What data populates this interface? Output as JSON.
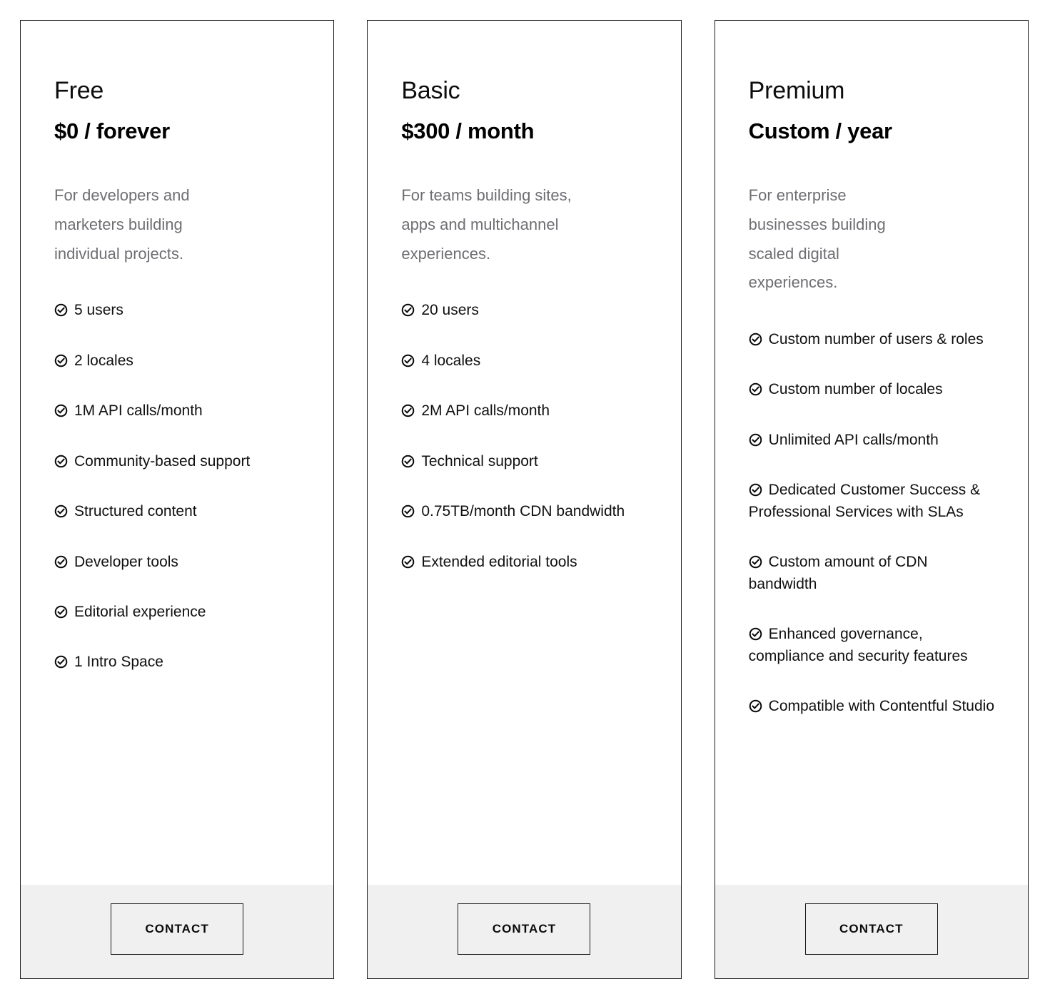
{
  "page": {
    "background": "#ffffff",
    "card_border_color": "#1a1a1a",
    "footer_background": "#f0f0f0",
    "description_color": "#6e6e73",
    "text_color": "#101010"
  },
  "icons": {
    "check": "circle-check-icon"
  },
  "plans": [
    {
      "id": "free",
      "name": "Free",
      "price": "$0 / forever",
      "description": "For developers and marketers building individual projects.",
      "features": [
        "5 users",
        "2 locales",
        "1M API calls/month",
        "Community-based support",
        "Structured content",
        "Developer tools",
        "Editorial experience",
        "1 Intro Space"
      ],
      "cta_label": "CONTACT"
    },
    {
      "id": "basic",
      "name": "Basic",
      "price": "$300 / month",
      "description": "For teams building sites, apps and multichannel experiences.",
      "features": [
        "20 users",
        "4 locales",
        "2M API calls/month",
        "Technical support",
        "0.75TB/month CDN bandwidth",
        "Extended editorial tools"
      ],
      "cta_label": "CONTACT"
    },
    {
      "id": "premium",
      "name": "Premium",
      "price": "Custom / year",
      "description": "For enterprise businesses building scaled digital experiences.",
      "features": [
        "Custom number of users & roles",
        "Custom number of locales",
        "Unlimited API calls/month",
        "Dedicated Customer Success & Professional Services with SLAs",
        "Custom amount of CDN bandwidth",
        "Enhanced governance, compliance and security features",
        "Compatible with Contentful Studio"
      ],
      "cta_label": "CONTACT"
    }
  ]
}
